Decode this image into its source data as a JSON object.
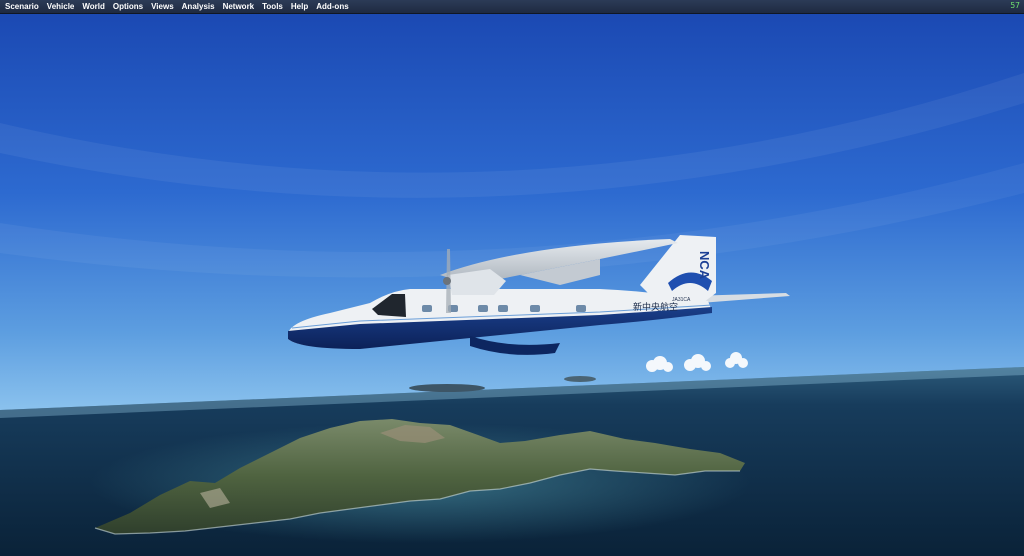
{
  "menubar": {
    "items": [
      "Scenario",
      "Vehicle",
      "World",
      "Options",
      "Views",
      "Analysis",
      "Network",
      "Tools",
      "Help",
      "Add-ons"
    ],
    "fps": "57"
  },
  "aircraft": {
    "logo": "NCA",
    "registration": "JA31CA",
    "livery_text": "新中央航空"
  },
  "colors": {
    "sky_top": "#1d4db8",
    "sky_horizon": "#6faee4",
    "sea": "#0f2e4a",
    "fuselage": "#eef1f4",
    "stripe": "#13377e",
    "menubar": "#24324c"
  }
}
